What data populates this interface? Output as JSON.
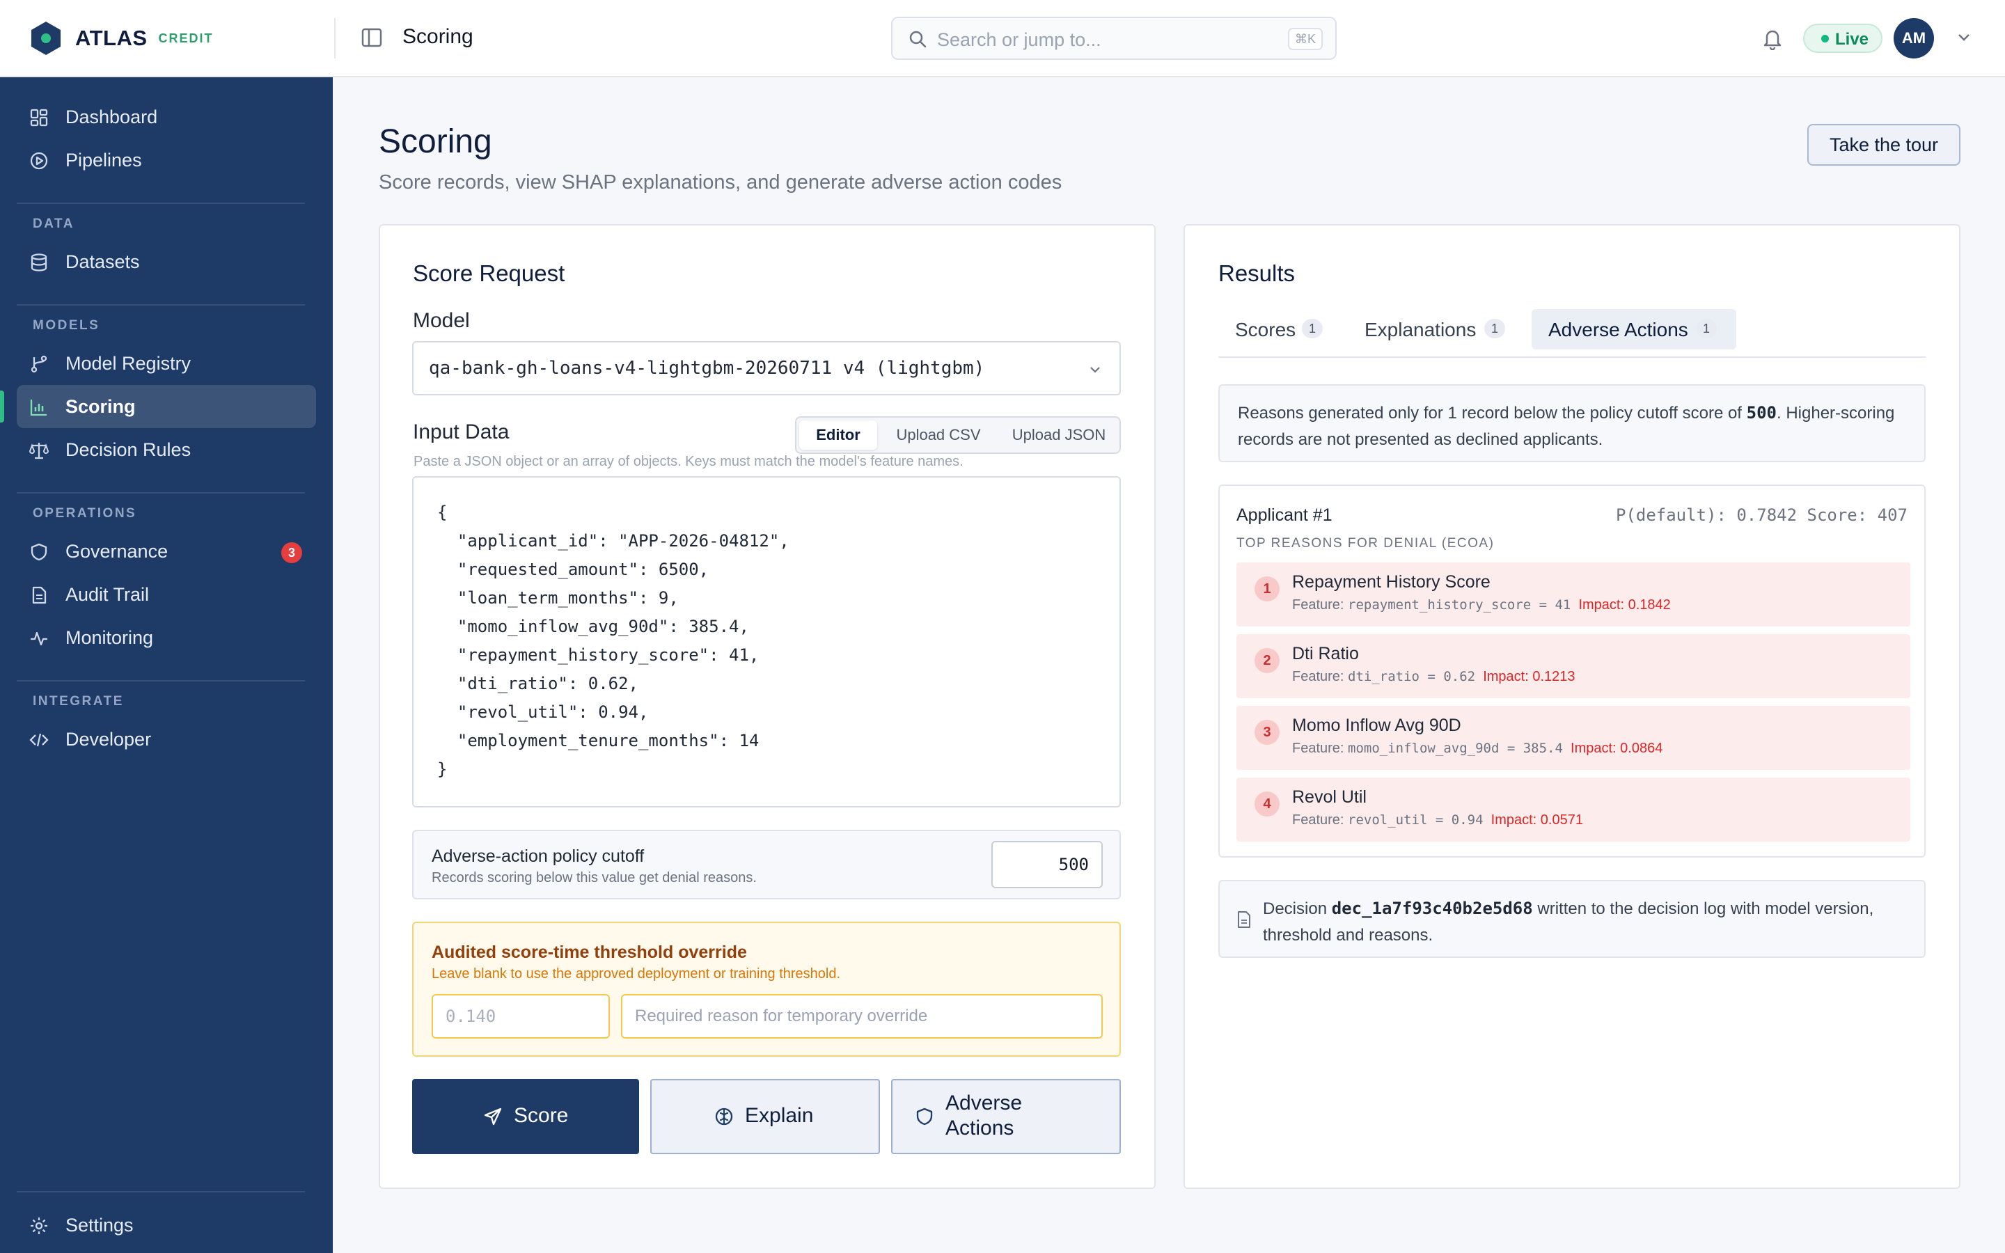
{
  "brand": {
    "name": "ATLAS",
    "sub": "CREDIT"
  },
  "topbar": {
    "crumb": "Scoring",
    "search_placeholder": "Search or jump to...",
    "search_kbd": "⌘K",
    "status": "Live",
    "avatar_initials": "AM"
  },
  "sidebar": {
    "items": [
      {
        "label": "Dashboard",
        "icon": "dashboard-icon"
      },
      {
        "label": "Pipelines",
        "icon": "play-circle-icon"
      },
      {
        "label": "Datasets",
        "icon": "database-icon"
      },
      {
        "label": "Model Registry",
        "icon": "branch-icon"
      },
      {
        "label": "Scoring",
        "icon": "bar-chart-icon"
      },
      {
        "label": "Decision Rules",
        "icon": "scale-icon"
      },
      {
        "label": "Governance",
        "icon": "shield-icon",
        "badge": "3"
      },
      {
        "label": "Audit Trail",
        "icon": "document-icon"
      },
      {
        "label": "Monitoring",
        "icon": "activity-icon"
      },
      {
        "label": "Developer",
        "icon": "code-icon"
      },
      {
        "label": "Settings",
        "icon": "gear-icon"
      }
    ],
    "sections": {
      "data": "DATA",
      "models": "MODELS",
      "operations": "OPERATIONS",
      "integrate": "INTEGRATE"
    },
    "active_color": "#2fbf86"
  },
  "page": {
    "title": "Scoring",
    "subtitle": "Score records, view SHAP explanations, and generate adverse action codes",
    "tour_button": "Take the tour"
  },
  "request": {
    "title": "Score Request",
    "model_label": "Model",
    "model_value": "qa-bank-gh-loans-v4-lightgbm-20260711 v4 (lightgbm)",
    "input_label": "Input Data",
    "input_modes": [
      "Editor",
      "Upload CSV",
      "Upload JSON"
    ],
    "input_hint": "Paste a JSON object or an array of objects. Keys must match the model's feature names.",
    "code_lines": [
      "{",
      "  \"applicant_id\": \"APP-2026-04812\",",
      "  \"requested_amount\": 6500,",
      "  \"loan_term_months\": 9,",
      "  \"momo_inflow_avg_90d\": 385.4,",
      "  \"repayment_history_score\": 41,",
      "  \"dti_ratio\": 0.62,",
      "  \"revol_util\": 0.94,",
      "  \"employment_tenure_months\": 14",
      "}"
    ],
    "cutoff_title": "Adverse-action policy cutoff",
    "cutoff_sub": "Records scoring below this value get denial reasons.",
    "cutoff_value": "500",
    "override_title": "Audited score-time threshold override",
    "override_sub": "Leave blank to use the approved deployment or training threshold.",
    "override_threshold_placeholder": "0.140",
    "override_reason_placeholder": "Required reason for temporary override",
    "buttons": {
      "score": "Score",
      "explain": "Explain",
      "adverse_line1": "Adverse",
      "adverse_line2": "Actions"
    }
  },
  "results": {
    "title": "Results",
    "tabs": [
      {
        "label": "Scores",
        "count": "1"
      },
      {
        "label": "Explanations",
        "count": "1"
      },
      {
        "label": "Adverse Actions",
        "count": "1"
      }
    ],
    "info_pre": "Reasons generated only for 1 record below the policy cutoff score of ",
    "info_value": "500",
    "info_post": ". Higher-scoring records are not presented as declined applicants.",
    "applicant_title": "Applicant #1",
    "applicant_meta": "P(default): 0.7842 Score: 407",
    "reasons_header": "TOP REASONS FOR DENIAL (ECOA)",
    "reasons": [
      {
        "num": "1",
        "title": "Repayment History Score",
        "feature": "repayment_history_score = 41",
        "impact": "Impact: 0.1842"
      },
      {
        "num": "2",
        "title": "Dti Ratio",
        "feature": "dti_ratio = 0.62",
        "impact": "Impact: 0.1213"
      },
      {
        "num": "3",
        "title": "Momo Inflow Avg 90D",
        "feature": "momo_inflow_avg_90d = 385.4",
        "impact": "Impact: 0.0864"
      },
      {
        "num": "4",
        "title": "Revol Util",
        "feature": "revol_util = 0.94",
        "impact": "Impact: 0.0571"
      }
    ],
    "feature_prefix": "Feature: ",
    "decision_pre": "Decision ",
    "decision_id": "dec_1a7f93c40b2e5d68",
    "decision_post": " written to the decision log with model version, threshold and reasons."
  }
}
